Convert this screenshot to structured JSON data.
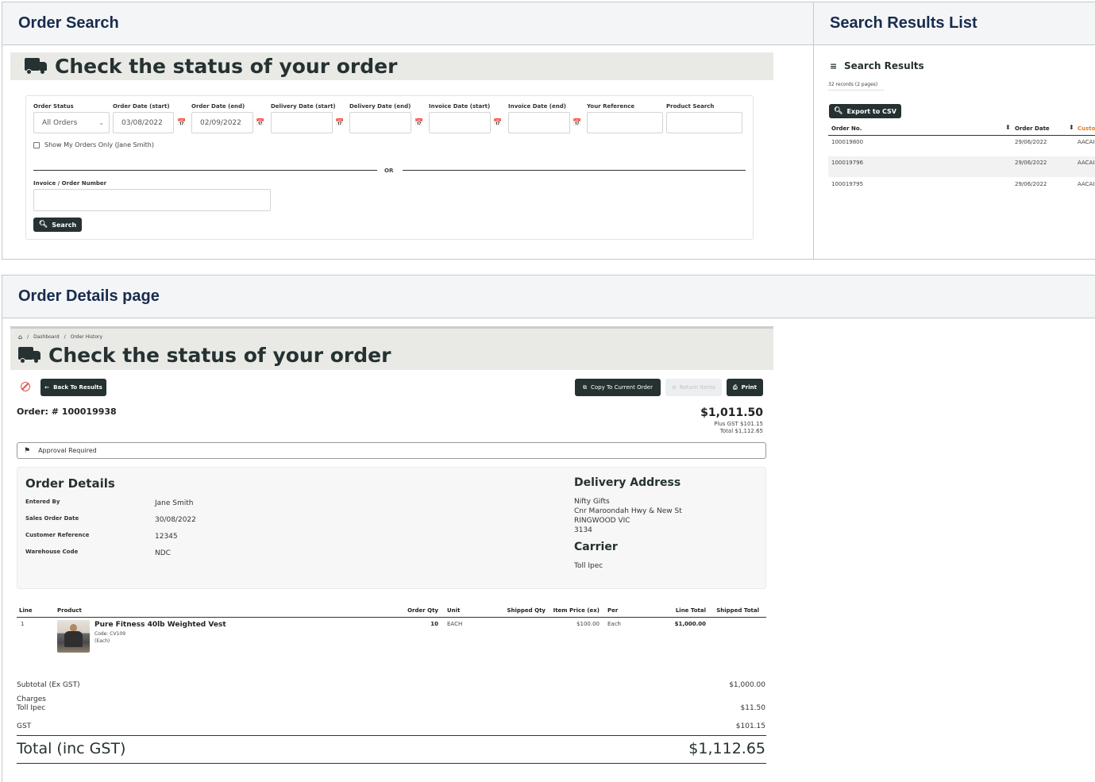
{
  "order_search": {
    "panel_title": "Order Search",
    "banner_title": "Check the status of your order",
    "filters": [
      {
        "label": "Order Status",
        "value": "All Orders"
      },
      {
        "label": "Order Date (start)",
        "value": "03/08/2022"
      },
      {
        "label": "Order Date (end)",
        "value": "02/09/2022"
      },
      {
        "label": "Delivery Date (start)",
        "value": ""
      },
      {
        "label": "Delivery Date (end)",
        "value": ""
      },
      {
        "label": "Invoice Date (start)",
        "value": ""
      },
      {
        "label": "Invoice Date (end)",
        "value": ""
      },
      {
        "label": "Your Reference",
        "value": ""
      },
      {
        "label": "Product Search",
        "value": ""
      }
    ],
    "my_orders_label": "Show My Orders Only (Jane Smith)",
    "divider_label": "OR",
    "invoice_label": "Invoice / Order Number",
    "search_button": "Search"
  },
  "results_list": {
    "panel_title": "Search Results List",
    "heading": "Search Results",
    "records": "32 records (2 pages)",
    "export_button": "Export to CSV",
    "columns": [
      "Order No.",
      "Order Date",
      "Custo"
    ],
    "rows": [
      {
        "order_no": "100019800",
        "date": "29/06/2022",
        "cust": "AACAI"
      },
      {
        "order_no": "100019796",
        "date": "29/06/2022",
        "cust": "AACAI"
      },
      {
        "order_no": "100019795",
        "date": "29/06/2022",
        "cust": "AACAI"
      }
    ]
  },
  "order_details": {
    "panel_title": "Order Details page",
    "breadcrumb": {
      "sep": "/",
      "dashboard": "Dashboard",
      "history": "Order History"
    },
    "banner_title": "Check the status of your order",
    "back_button": "Back To Results",
    "copy_button": "Copy To Current Order",
    "return_button": "Return Items",
    "print_button": "Print",
    "order_number": "Order: # 100019938",
    "amount": "$1,011.50",
    "plus_gst": "Plus GST $101.15",
    "total_small": "Total $1,112.65",
    "approval": "Approval Required",
    "details_heading": "Order Details",
    "details": [
      {
        "label": "Entered By",
        "value": "Jane Smith"
      },
      {
        "label": "Sales Order Date",
        "value": "30/08/2022"
      },
      {
        "label": "Customer Reference",
        "value": "12345"
      },
      {
        "label": "Warehouse Code",
        "value": "NDC"
      }
    ],
    "delivery_heading": "Delivery Address",
    "address": [
      "Nifty Gifts",
      "Cnr Maroondah Hwy & New St",
      "RINGWOOD VIC",
      "3134"
    ],
    "carrier_heading": "Carrier",
    "carrier": "Toll Ipec",
    "line_columns": {
      "line": "Line",
      "product": "Product",
      "order_qty": "Order Qty",
      "unit": "Unit",
      "shipped_qty": "Shipped Qty",
      "item_price": "Item Price (ex)",
      "per": "Per",
      "line_total": "Line Total",
      "shipped_total": "Shipped Total"
    },
    "line_item": {
      "line": "1",
      "name": "Pure Fitness 40lb Weighted Vest",
      "code": "Code: CV109",
      "each": "(Each)",
      "order_qty": "10",
      "unit": "EACH",
      "item_price": "$100.00",
      "per": "Each",
      "line_total": "$1,000.00"
    },
    "subtotal_label": "Subtotal (Ex GST)",
    "subtotal_value": "$1,000.00",
    "charges_label": "Charges",
    "charge_name": "Toll Ipec",
    "charge_value": "$11.50",
    "gst_label": "GST",
    "gst_value": "$101.15",
    "total_label": "Total (inc GST)",
    "total_value": "$1,112.65"
  }
}
